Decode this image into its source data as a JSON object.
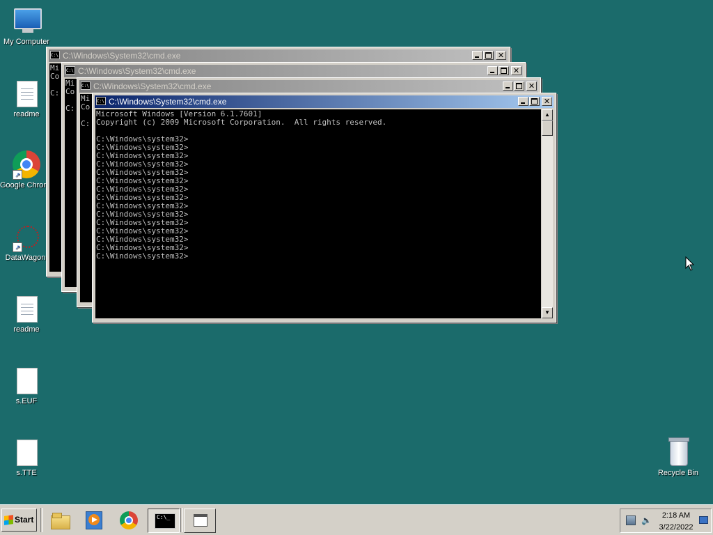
{
  "desktop": {
    "icons": [
      {
        "label": "My Computer",
        "icon": "computer-icon"
      },
      {
        "label": "readme",
        "icon": "text-document-icon"
      },
      {
        "label": "Google Chrome",
        "icon": "chrome-icon"
      },
      {
        "label": "DataWagon.",
        "icon": "datawagon-icon"
      },
      {
        "label": "readme",
        "icon": "text-document-icon"
      },
      {
        "label": "s.EUF",
        "icon": "blank-file-icon"
      },
      {
        "label": "s.TTE",
        "icon": "blank-file-icon"
      },
      {
        "label": "Recycle Bin",
        "icon": "recycle-bin-icon"
      }
    ]
  },
  "windows": [
    {
      "title": "C:\\Windows\\System32\\cmd.exe",
      "peek": [
        "Mi",
        "Co",
        "",
        "C:"
      ]
    },
    {
      "title": "C:\\Windows\\System32\\cmd.exe",
      "peek": [
        "Mi",
        "Co",
        "",
        "C:"
      ]
    },
    {
      "title": "C:\\Windows\\System32\\cmd.exe",
      "peek": [
        "Mi",
        "Co",
        "",
        "C:"
      ]
    },
    {
      "title": "C:\\Windows\\System32\\cmd.exe",
      "console": "Microsoft Windows [Version 6.1.7601]\nCopyright (c) 2009 Microsoft Corporation.  All rights reserved.\n\nC:\\Windows\\system32>\nC:\\Windows\\system32>\nC:\\Windows\\system32>\nC:\\Windows\\system32>\nC:\\Windows\\system32>\nC:\\Windows\\system32>\nC:\\Windows\\system32>\nC:\\Windows\\system32>\nC:\\Windows\\system32>\nC:\\Windows\\system32>\nC:\\Windows\\system32>\nC:\\Windows\\system32>\nC:\\Windows\\system32>\nC:\\Windows\\system32>\nC:\\Windows\\system32>"
    }
  ],
  "taskbar": {
    "start_label": "Start",
    "items": [
      {
        "icon": "file-explorer-icon"
      },
      {
        "icon": "media-player-icon"
      },
      {
        "icon": "chrome-icon"
      },
      {
        "icon": "cmd-icon",
        "pressed": true
      },
      {
        "icon": "window-icon"
      }
    ],
    "clock": {
      "time": "2:18 AM",
      "date": "3/22/2022"
    }
  },
  "colors": {
    "desktop": "#1b6b6b",
    "title_active": "#0a246a",
    "title_inactive": "#808080"
  }
}
